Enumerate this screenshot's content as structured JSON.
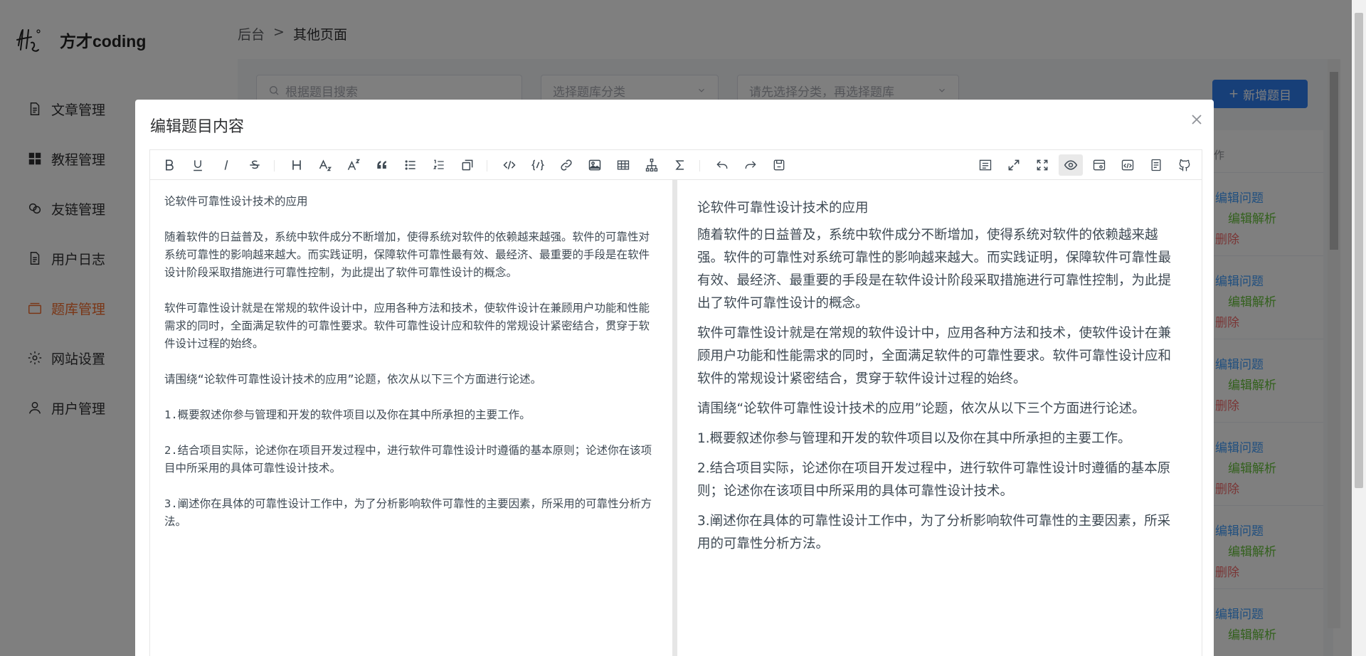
{
  "brand": {
    "name": "方才coding"
  },
  "sidebar": {
    "items": [
      {
        "label": "文章管理",
        "icon": "document-icon"
      },
      {
        "label": "教程管理",
        "icon": "grid-icon"
      },
      {
        "label": "友链管理",
        "icon": "link-icon"
      },
      {
        "label": "用户日志",
        "icon": "log-icon"
      },
      {
        "label": "题库管理",
        "icon": "box-icon",
        "active": true
      },
      {
        "label": "网站设置",
        "icon": "gear-icon"
      },
      {
        "label": "用户管理",
        "icon": "user-icon"
      }
    ],
    "active_color": "#f56c2d"
  },
  "breadcrumb": {
    "root": "后台",
    "sep": ">",
    "current": "其他页面"
  },
  "filters": {
    "search_placeholder": "根据题目搜索",
    "category_placeholder": "选择题库分类",
    "bank_placeholder": "请先选择分类，再选择题库"
  },
  "new_button": {
    "label": "新增题目"
  },
  "list": {
    "header": "作",
    "action_edit": "编辑问题",
    "action_analysis": "编辑解析",
    "action_delete": "删除"
  },
  "dialog": {
    "title": "编辑题目内容",
    "close": "×",
    "toolbar": {
      "left": [
        "bold-icon",
        "underline-icon",
        "italic-icon",
        "strikethrough-icon",
        "heading-icon",
        "subscript-icon",
        "superscript-icon",
        "quote-icon",
        "unordered-list-icon",
        "ordered-list-icon",
        "task-list-icon",
        "inline-code-icon",
        "code-block-icon",
        "link-icon",
        "image-icon",
        "table-icon",
        "mermaid-icon",
        "formula-icon",
        "undo-icon",
        "redo-icon",
        "save-icon"
      ],
      "right": [
        "outline-icon",
        "fullscreen-icon",
        "page-fullscreen-icon",
        "preview-icon",
        "preview-only-icon",
        "html-preview-icon",
        "catalog-icon",
        "github-icon"
      ]
    },
    "editor_source": "论软件可靠性设计技术的应用\n\n随着软件的日益普及，系统中软件成分不断增加，使得系统对软件的依赖越来越强。软件的可靠性对系统可靠性的影响越来越大。而实践证明，保障软件可靠性最有效、最经济、最重要的手段是在软件设计阶段采取措施进行可靠性控制，为此提出了软件可靠性设计的概念。\n\n软件可靠性设计就是在常规的软件设计中，应用各种方法和技术，使软件设计在兼顾用户功能和性能需求的同时，全面满足软件的可靠性要求。软件可靠性设计应和软件的常规设计紧密结合，贯穿于软件设计过程的始终。\n\n请围绕“论软件可靠性设计技术的应用”论题，依次从以下三个方面进行论述。\n\n1.概要叙述你参与管理和开发的软件项目以及你在其中所承担的主要工作。\n\n2.结合项目实际，论述你在项目开发过程中，进行软件可靠性设计时遵循的基本原则；论述你在该项目中所采用的具体可靠性设计技术。\n\n3.阐述你在具体的可靠性设计工作中，为了分析影响软件可靠性的主要因素，所采用的可靠性分析方法。",
    "preview": [
      "论软件可靠性设计技术的应用",
      "随着软件的日益普及，系统中软件成分不断增加，使得系统对软件的依赖越来越强。软件的可靠性对系统可靠性的影响越来越大。而实践证明，保障软件可靠性最有效、最经济、最重要的手段是在软件设计阶段采取措施进行可靠性控制，为此提出了软件可靠性设计的概念。",
      "软件可靠性设计就是在常规的软件设计中，应用各种方法和技术，使软件设计在兼顾用户功能和性能需求的同时，全面满足软件的可靠性要求。软件可靠性设计应和软件的常规设计紧密结合，贯穿于软件设计过程的始终。",
      "请围绕“论软件可靠性设计技术的应用”论题，依次从以下三个方面进行论述。",
      "1.概要叙述你参与管理和开发的软件项目以及你在其中所承担的主要工作。",
      "2.结合项目实际，论述你在项目开发过程中，进行软件可靠性设计时遵循的基本原则；论述你在该项目中所采用的具体可靠性设计技术。",
      "3.阐述你在具体的可靠性设计工作中，为了分析影响软件可靠性的主要因素，所采用的可靠性分析方法。"
    ]
  }
}
